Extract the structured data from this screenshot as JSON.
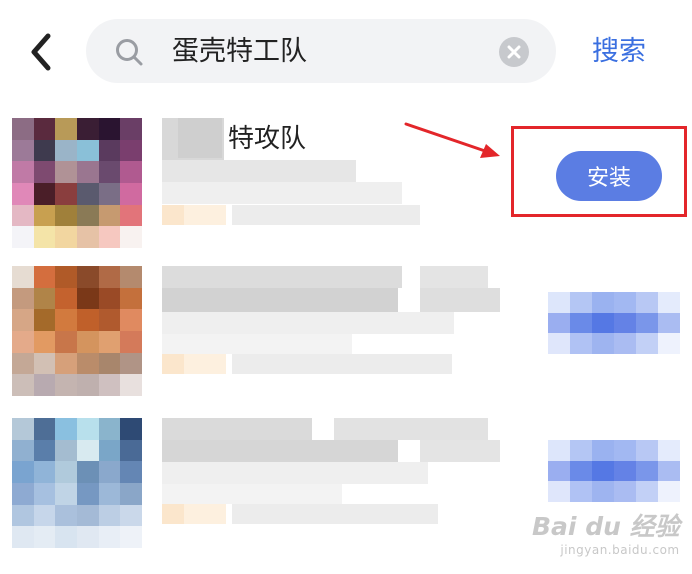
{
  "search": {
    "query": "蛋壳特工队",
    "button_label": "搜索"
  },
  "results": [
    {
      "name_visible": "特攻队",
      "install_label": "安装"
    }
  ],
  "annotation": {
    "color": "#e3262a"
  },
  "accent_color": "#5b7de3",
  "watermark": {
    "logo": "Bai du 经验",
    "url": "jingyan.baidu.com"
  },
  "icons": [
    "back-arrow-icon",
    "search-icon",
    "clear-icon",
    "arrow-annotation-icon"
  ]
}
